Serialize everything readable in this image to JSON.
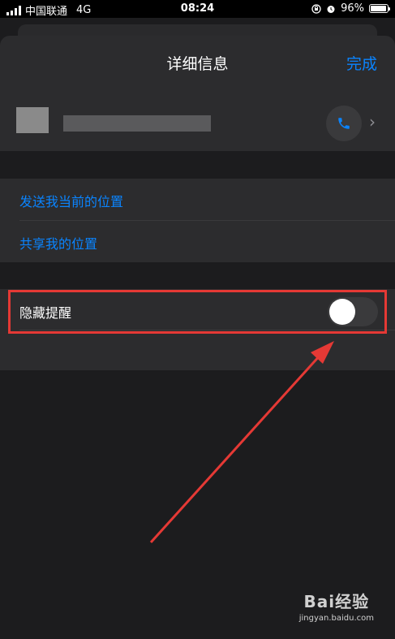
{
  "status_bar": {
    "carrier": "中国联通",
    "network": "4G",
    "time": "08:24",
    "battery": "96%",
    "battery_level": 0.96
  },
  "nav": {
    "title": "详细信息",
    "done_label": "完成"
  },
  "contact": {
    "call_icon": "phone-icon",
    "chevron_icon": "chevron-right-icon"
  },
  "location": {
    "send_current": "发送我当前的位置",
    "share": "共享我的位置"
  },
  "alerts": {
    "hide_alerts_label": "隐藏提醒",
    "toggle_on": false
  },
  "watermark": {
    "logo": "Bai经验",
    "url": "jingyan.baidu.com"
  },
  "colors": {
    "accent": "#0a84ff",
    "background": "#1c1c1e",
    "cell": "#2c2c2e",
    "highlight": "#e53935"
  }
}
